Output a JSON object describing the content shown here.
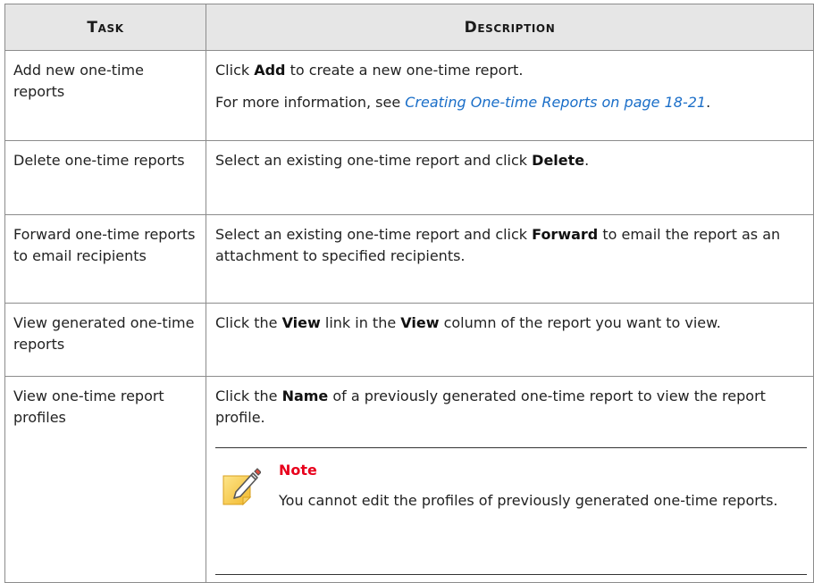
{
  "table": {
    "header": {
      "task": "Task",
      "description": "Description"
    },
    "rows": [
      {
        "task": "Add new one-time reports",
        "desc_1_prefix": "Click ",
        "desc_1_bold": "Add",
        "desc_1_suffix": " to create a new one-time report.",
        "desc_2_prefix": "For more information, see ",
        "desc_2_link": "Creating One-time Reports on page 18-21",
        "desc_2_suffix": "."
      },
      {
        "task": "Delete one-time reports",
        "desc_prefix": "Select an existing one-time report and click ",
        "desc_bold": "Delete",
        "desc_suffix": "."
      },
      {
        "task": "Forward one-time reports to email recipients",
        "desc_prefix": "Select an existing one-time report and click ",
        "desc_bold": "Forward",
        "desc_suffix": " to email the report as an attachment to specified recipients."
      },
      {
        "task": "View generated one-time reports",
        "desc_prefix": "Click the ",
        "desc_bold_1": "View",
        "desc_middle": " link in the ",
        "desc_bold_2": "View",
        "desc_suffix": " column of the report you want to view."
      },
      {
        "task": "View one-time report profiles",
        "desc_prefix": "Click the ",
        "desc_bold": "Name",
        "desc_suffix": " of a previously generated one-time report to view the report profile.",
        "note": {
          "title": "Note",
          "text": "You cannot edit the profiles of previously generated one-time reports.",
          "icon": "note-pencil-icon"
        }
      }
    ]
  },
  "colors": {
    "header_bg": "#e6e6e6",
    "link": "#1a6ec8",
    "note_title": "#e8001c",
    "note_icon": "#f6c744"
  }
}
